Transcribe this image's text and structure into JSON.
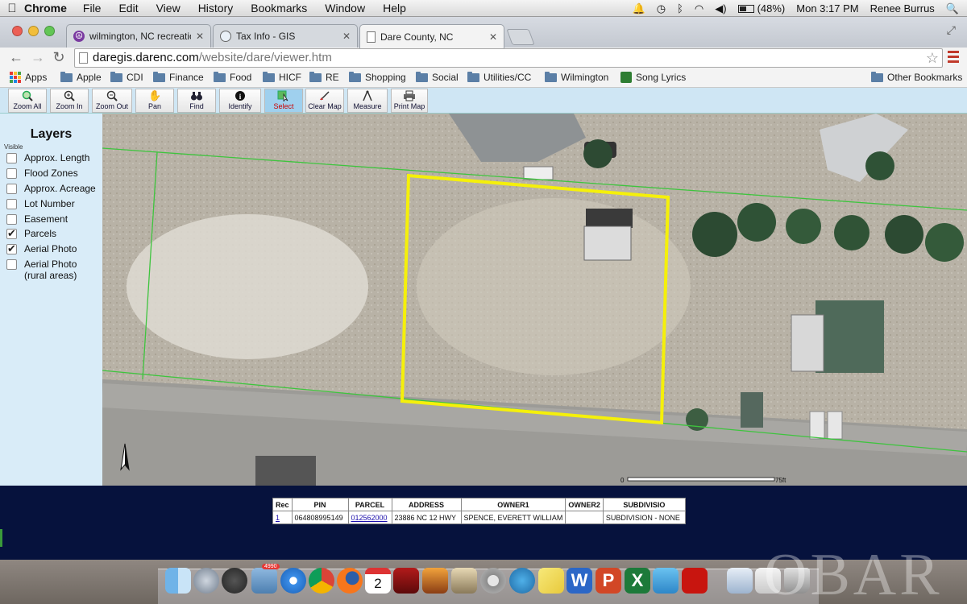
{
  "menubar": {
    "app_name": "Chrome",
    "menus": [
      "File",
      "Edit",
      "View",
      "History",
      "Bookmarks",
      "Window",
      "Help"
    ],
    "battery": "(48%)",
    "clock": "Mon 3:17 PM",
    "user": "Renee Burrus"
  },
  "tabs": [
    {
      "title": "wilmington, NC recreation",
      "icon": "peace-icon",
      "active": false
    },
    {
      "title": "Tax Info - GIS",
      "icon": "globe-icon",
      "active": false
    },
    {
      "title": "Dare County, NC",
      "icon": "page-icon",
      "active": true
    }
  ],
  "address_bar": {
    "host": "daregis.darenc.com",
    "path": "/website/dare/viewer.htm"
  },
  "bookmarks": [
    {
      "label": "Apps",
      "icon": "apps-icon"
    },
    {
      "label": "Apple",
      "icon": "folder-icon"
    },
    {
      "label": "CDI",
      "icon": "folder-icon"
    },
    {
      "label": "Finance",
      "icon": "folder-icon"
    },
    {
      "label": "Food",
      "icon": "folder-icon"
    },
    {
      "label": "HICF",
      "icon": "folder-icon"
    },
    {
      "label": "RE",
      "icon": "folder-icon"
    },
    {
      "label": "Shopping",
      "icon": "folder-icon"
    },
    {
      "label": "Social",
      "icon": "folder-icon"
    },
    {
      "label": "Utilities/CC",
      "icon": "folder-icon"
    },
    {
      "label": "Wilmington",
      "icon": "folder-icon"
    },
    {
      "label": "Song Lyrics",
      "icon": "bookmark-icon"
    },
    {
      "label": "Other Bookmarks",
      "icon": "folder-icon"
    }
  ],
  "gis_toolbar": [
    {
      "label": "Zoom All",
      "icon": "zoom-all-icon"
    },
    {
      "label": "Zoom In",
      "icon": "zoom-in-icon"
    },
    {
      "label": "Zoom Out",
      "icon": "zoom-out-icon"
    },
    {
      "label": "Pan",
      "icon": "hand-icon"
    },
    {
      "label": "Find",
      "icon": "binoculars-icon"
    },
    {
      "label": "Identify",
      "icon": "info-icon"
    },
    {
      "label": "Select",
      "icon": "select-icon",
      "selected": true
    },
    {
      "label": "Clear Map",
      "icon": "clear-icon"
    },
    {
      "label": "Measure",
      "icon": "measure-icon"
    },
    {
      "label": "Print Map",
      "icon": "printer-icon"
    }
  ],
  "layers": {
    "title": "Layers",
    "visible_label": "Visible",
    "items": [
      {
        "label": "Approx. Length",
        "checked": false
      },
      {
        "label": "Flood Zones",
        "checked": false
      },
      {
        "label": "Approx. Acreage",
        "checked": false
      },
      {
        "label": "Lot Number",
        "checked": false
      },
      {
        "label": "Easement",
        "checked": false
      },
      {
        "label": "Parcels",
        "checked": true
      },
      {
        "label": "Aerial Photo",
        "checked": true
      },
      {
        "label": "Aerial Photo\n(rural areas)",
        "checked": false
      }
    ]
  },
  "map": {
    "scale_start": "0",
    "scale_end": "75ft",
    "north_arrow": "north-arrow-icon"
  },
  "results": {
    "columns": [
      "Rec",
      "PIN",
      "PARCEL",
      "ADDRESS",
      "OWNER1",
      "OWNER2",
      "SUBDIVISIO"
    ],
    "rows": [
      [
        "1",
        "064808995149",
        "012562000",
        "23886 NC 12 HWY",
        "SPENCE, EVERETT WILLIAM",
        "",
        "SUBDIVISION - NONE"
      ]
    ]
  },
  "watermark": "OBAR",
  "dock": {
    "calendar_day": "2",
    "mail_badge": "4990"
  },
  "colors": {
    "selection": "#f5f00a",
    "parcel_lines": "#3ec43e",
    "results_bg": "#06123d",
    "layers_bg": "#d9ecf8"
  }
}
